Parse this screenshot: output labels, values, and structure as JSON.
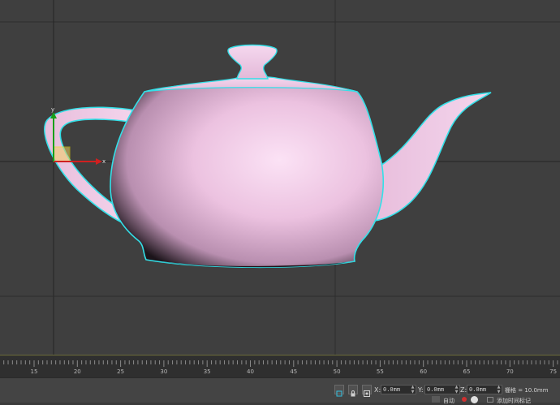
{
  "viewport": {
    "gizmo_axis_x": "x",
    "gizmo_axis_y": "y"
  },
  "timeline": {
    "ticks": [
      "15",
      "20",
      "25",
      "30",
      "35",
      "40",
      "45",
      "50",
      "55",
      "60",
      "65",
      "70",
      "75"
    ]
  },
  "status": {
    "x_label": "X:",
    "x_value": "0.0mm",
    "y_label": "Y:",
    "y_value": "0.0mm",
    "z_label": "Z:",
    "z_value": "0.0mm",
    "grid_text": "栅格 = 10.0mm",
    "set_key_partial": "自动",
    "tag_partial": "添加时间标记"
  },
  "colors": {
    "teapot": "#f0c8e4",
    "selection": "#33e0e8",
    "axis_x": "#d02020",
    "axis_y": "#18a018"
  },
  "icons": {
    "snap": "snap-icon",
    "lock": "lock-icon",
    "absolute": "absolute-mode-icon"
  }
}
